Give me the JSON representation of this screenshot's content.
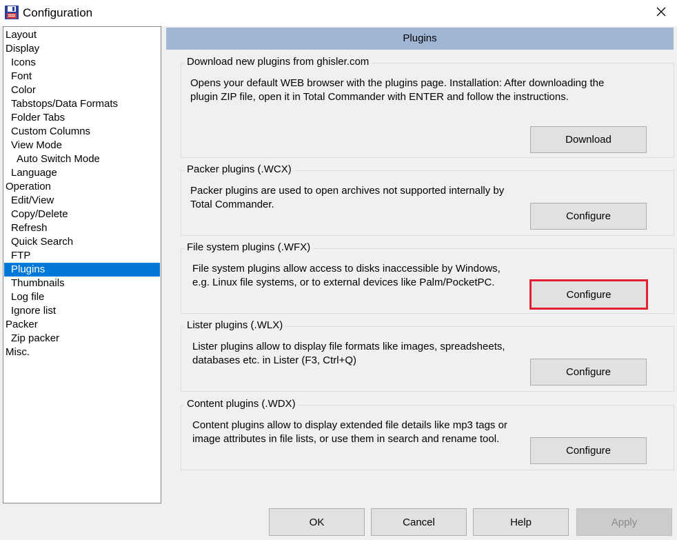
{
  "window": {
    "title": "Configuration",
    "icon": "floppy-disk-icon",
    "close_icon": "close-icon"
  },
  "tree": {
    "items": [
      {
        "label": "Layout",
        "level": 0
      },
      {
        "label": "Display",
        "level": 0
      },
      {
        "label": "Icons",
        "level": 1
      },
      {
        "label": "Font",
        "level": 1
      },
      {
        "label": "Color",
        "level": 1
      },
      {
        "label": "Tabstops/Data Formats",
        "level": 1
      },
      {
        "label": "Folder Tabs",
        "level": 1
      },
      {
        "label": "Custom Columns",
        "level": 1
      },
      {
        "label": "View Mode",
        "level": 1
      },
      {
        "label": "Auto Switch Mode",
        "level": 2
      },
      {
        "label": "Language",
        "level": 1
      },
      {
        "label": "Operation",
        "level": 0
      },
      {
        "label": "Edit/View",
        "level": 1
      },
      {
        "label": "Copy/Delete",
        "level": 1
      },
      {
        "label": "Refresh",
        "level": 1
      },
      {
        "label": "Quick Search",
        "level": 1
      },
      {
        "label": "FTP",
        "level": 1
      },
      {
        "label": "Plugins",
        "level": 1,
        "selected": true
      },
      {
        "label": "Thumbnails",
        "level": 1
      },
      {
        "label": "Log file",
        "level": 1
      },
      {
        "label": "Ignore list",
        "level": 1
      },
      {
        "label": "Packer",
        "level": 0
      },
      {
        "label": "Zip packer",
        "level": 1
      },
      {
        "label": "Misc.",
        "level": 0
      }
    ]
  },
  "panel": {
    "header": "Plugins",
    "groups": [
      {
        "title": "Download new plugins from ghisler.com",
        "desc_line1": "Opens your default WEB browser with the plugins page. Installation: After downloading the",
        "desc_line2": "plugin ZIP file, open it in Total Commander with ENTER and follow the instructions.",
        "button": "Download"
      },
      {
        "title": "Packer plugins (.WCX)",
        "desc_line1": "Packer plugins are used to open archives not supported internally by",
        "desc_line2": "Total Commander.",
        "button": "Configure"
      },
      {
        "title": "File system plugins (.WFX)",
        "desc_line1": "File system plugins allow access to disks inaccessible by Windows,",
        "desc_line2": "e.g. Linux file systems, or to external devices like Palm/PocketPC.",
        "button": "Configure"
      },
      {
        "title": "Lister plugins (.WLX)",
        "desc_line1": "Lister plugins allow to display file formats like images, spreadsheets,",
        "desc_line2": "databases etc. in Lister (F3, Ctrl+Q)",
        "button": "Configure"
      },
      {
        "title": "Content plugins (.WDX)",
        "desc_line1": "Content plugins allow to display extended file details like mp3 tags or",
        "desc_line2": "image attributes in file lists, or use them in search and rename tool.",
        "button": "Configure"
      }
    ]
  },
  "footer": {
    "ok": "OK",
    "cancel": "Cancel",
    "help": "Help",
    "apply": "Apply"
  },
  "colors": {
    "selection": "#0078d7",
    "header_bg": "#9fb7d4",
    "highlight_border": "#e0202e"
  }
}
